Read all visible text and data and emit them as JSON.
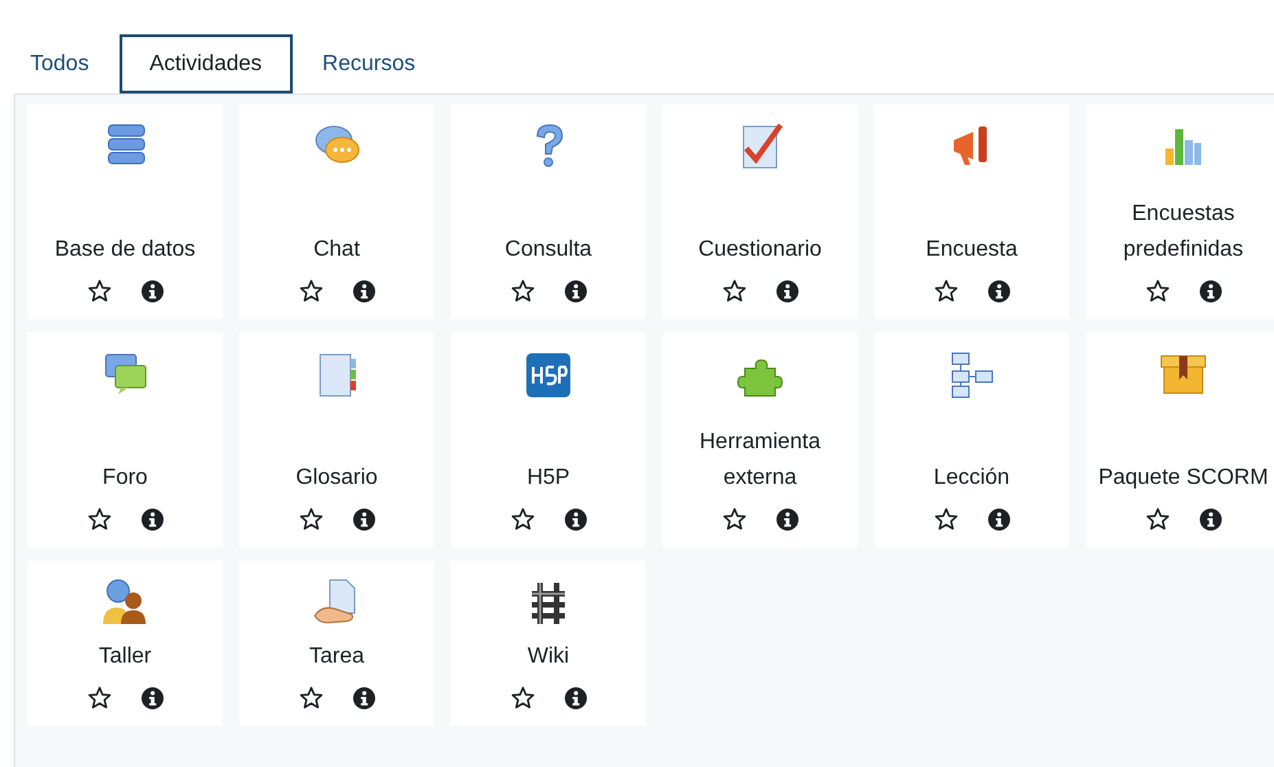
{
  "tabs": [
    {
      "label": "Todos",
      "selected": false
    },
    {
      "label": "Actividades",
      "selected": true
    },
    {
      "label": "Recursos",
      "selected": false
    }
  ],
  "activities": [
    {
      "label": "Base de datos",
      "starred": false
    },
    {
      "label": "Chat",
      "starred": false
    },
    {
      "label": "Consulta",
      "starred": false
    },
    {
      "label": "Cuestionario",
      "starred": false
    },
    {
      "label": "Encuesta",
      "starred": false
    },
    {
      "label": "Encuestas predefinidas",
      "starred": false
    },
    {
      "label": "Foro",
      "starred": false
    },
    {
      "label": "Glosario",
      "starred": false
    },
    {
      "label": "H5P",
      "starred": false
    },
    {
      "label": "Herramienta externa",
      "starred": false
    },
    {
      "label": "Lección",
      "starred": false
    },
    {
      "label": "Paquete SCORM",
      "starred": false
    },
    {
      "label": "Taller",
      "starred": false
    },
    {
      "label": "Tarea",
      "starred": false
    },
    {
      "label": "Wiki",
      "starred": false
    }
  ]
}
